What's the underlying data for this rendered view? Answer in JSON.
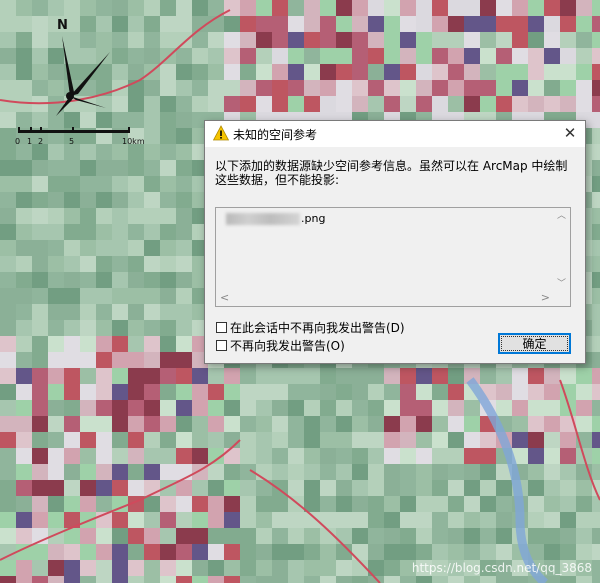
{
  "map": {
    "north_label": "N",
    "scale_labels": [
      "0",
      "1",
      "2",
      "5",
      "10km"
    ]
  },
  "dialog": {
    "title": "未知的空间参考",
    "message": "以下添加的数据源缺少空间参考信息。虽然可以在 ArcMap 中绘制这些数据，但不能投影:",
    "list_entries": [
      ".png"
    ],
    "checkbox_session_label": "在此会话中不再向我发出警告(D)",
    "checkbox_never_label": "不再向我发出警告(O)",
    "ok_label": "确定",
    "icons": {
      "title": "warning-icon",
      "close": "close-icon"
    }
  },
  "watermark": "https://blog.csdn.net/qq_3868"
}
